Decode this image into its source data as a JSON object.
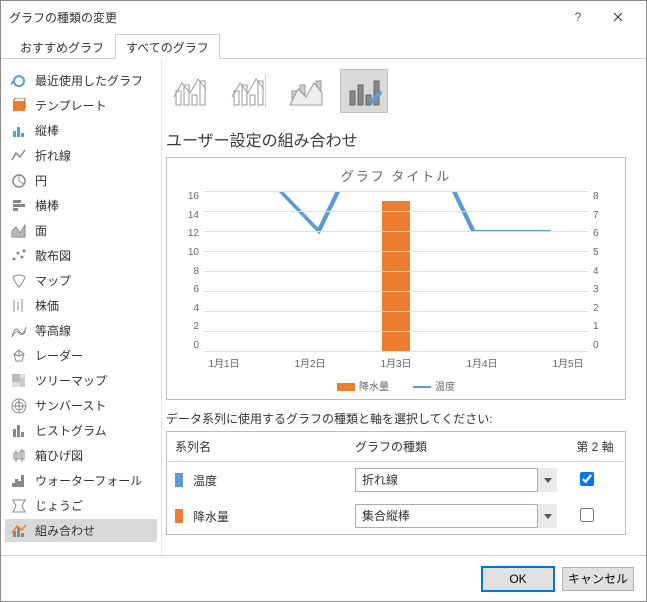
{
  "window": {
    "title": "グラフの種類の変更",
    "help": "?",
    "close": "×"
  },
  "tabs": [
    "おすすめグラフ",
    "すべてのグラフ"
  ],
  "active_tab": 1,
  "sidebar": {
    "items": [
      {
        "label": "最近使用したグラフ"
      },
      {
        "label": "テンプレート"
      },
      {
        "label": "縦棒"
      },
      {
        "label": "折れ線"
      },
      {
        "label": "円"
      },
      {
        "label": "横棒"
      },
      {
        "label": "面"
      },
      {
        "label": "散布図"
      },
      {
        "label": "マップ"
      },
      {
        "label": "株価"
      },
      {
        "label": "等高線"
      },
      {
        "label": "レーダー"
      },
      {
        "label": "ツリーマップ"
      },
      {
        "label": "サンバースト"
      },
      {
        "label": "ヒストグラム"
      },
      {
        "label": "箱ひげ図"
      },
      {
        "label": "ウォーターフォール"
      },
      {
        "label": "じょうご"
      },
      {
        "label": "組み合わせ"
      }
    ],
    "selected_index": 18
  },
  "section_title": "ユーザー設定の組み合わせ",
  "chart_data": {
    "type": "combo",
    "title": "グラフ タイトル",
    "categories": [
      "1月1日",
      "1月2日",
      "1月3日",
      "1月4日",
      "1月5日"
    ],
    "series": [
      {
        "name": "降水量",
        "type": "bar",
        "axis": "primary",
        "values": [
          0,
          0,
          15,
          0,
          0
        ],
        "color": "#ed7d31"
      },
      {
        "name": "温度",
        "type": "line",
        "axis": "secondary",
        "values": [
          10,
          6,
          14,
          6,
          6
        ],
        "color": "#5b9bd5"
      }
    ],
    "ylim_primary": [
      0,
      16
    ],
    "ylim_secondary": [
      0,
      8
    ],
    "y_ticks_primary": [
      16,
      14,
      12,
      10,
      8,
      6,
      4,
      2,
      0
    ],
    "y_ticks_secondary": [
      8,
      7,
      6,
      5,
      4,
      3,
      2,
      1,
      0
    ],
    "legend": [
      "降水量",
      "温度"
    ]
  },
  "series_panel": {
    "instruction": "データ系列に使用するグラフの種類と軸を選択してください:",
    "headers": {
      "name": "系列名",
      "type": "グラフの種類",
      "axis": "第 2 軸"
    },
    "rows": [
      {
        "marker": "blue",
        "name": "温度",
        "chart_type": "折れ線",
        "secondary_axis": true
      },
      {
        "marker": "orange",
        "name": "降水量",
        "chart_type": "集合縦棒",
        "secondary_axis": false
      }
    ]
  },
  "footer": {
    "ok": "OK",
    "cancel": "キャンセル"
  }
}
